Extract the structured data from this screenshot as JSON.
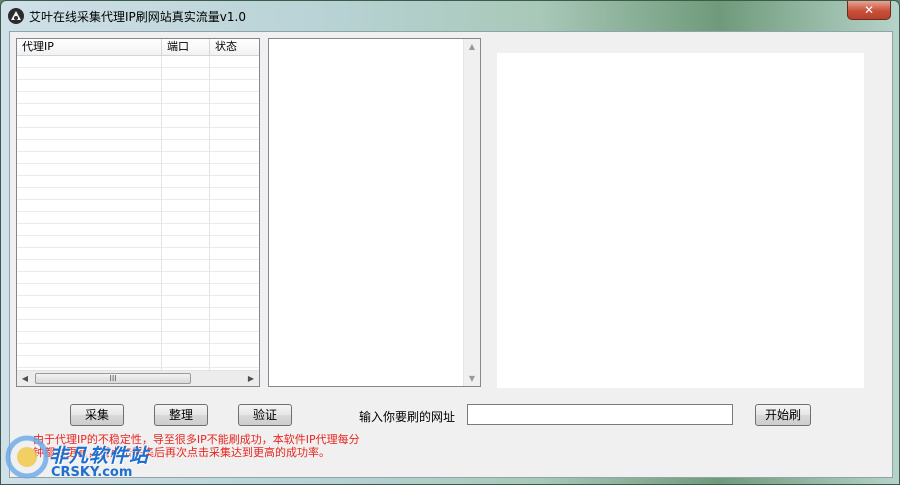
{
  "window": {
    "title": "艾叶在线采集代理IP刷网站真实流量v1.0",
    "close_label": "✕"
  },
  "proxy_list": {
    "columns": [
      "代理IP",
      "端口",
      "状态"
    ],
    "rows": [],
    "scroll_grip": "III",
    "scroll_left": "◀",
    "scroll_right": "▶"
  },
  "log_box": {
    "text": "",
    "scroll_up": "▲",
    "scroll_down": "▼"
  },
  "buttons": {
    "collect": "采集",
    "organize": "整理",
    "verify": "验证",
    "start": "开始刷"
  },
  "url_entry": {
    "label": "输入你要刷的网址",
    "value": ""
  },
  "notice": {
    "line1": "由于代理IP的不稳定性，导至很多IP不能刷成功，本软件IP代理每分",
    "line2": "钟都会更新，请点击采集后再次点击采集达到更高的成功率。"
  },
  "watermark": {
    "name": "非凡软件站",
    "domain": "CRSKY.com"
  },
  "colors": {
    "notice_text": "#e8261f",
    "watermark": "#1d6fd0",
    "close_button": "#c8503a"
  }
}
